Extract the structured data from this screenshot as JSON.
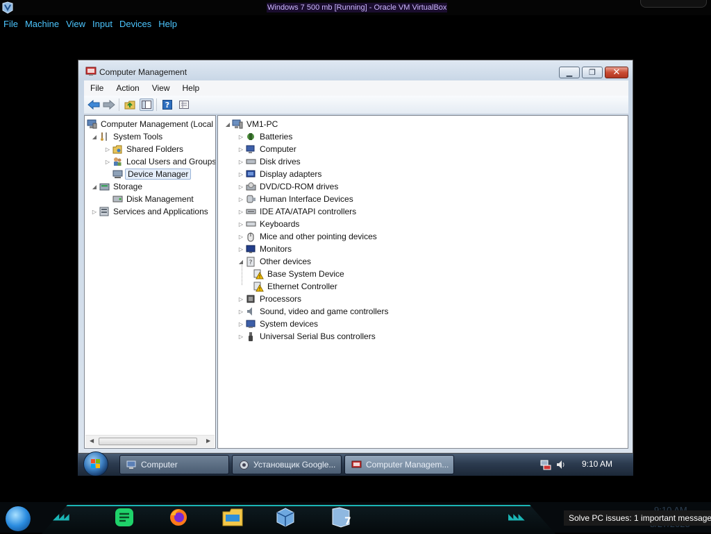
{
  "host": {
    "window_title": "Windows 7 500 mb [Running] - Oracle VM VirtualBox",
    "menu": [
      "File",
      "Machine",
      "View",
      "Input",
      "Devices",
      "Help"
    ]
  },
  "cm_window": {
    "title": "Computer Management",
    "menu": [
      "File",
      "Action",
      "View",
      "Help"
    ],
    "toolbar": [
      "back-icon",
      "forward-icon",
      "up-folder-icon",
      "show-hide-tree-icon",
      "help-icon",
      "properties-icon"
    ],
    "left_tree": [
      {
        "label": "Computer Management (Local",
        "expander": "",
        "icon": "computer-management-icon",
        "level": 0
      },
      {
        "label": "System Tools",
        "expander": "expanded",
        "icon": "tools-icon",
        "level": 1
      },
      {
        "label": "Shared Folders",
        "expander": "collapsed",
        "icon": "shared-folder-icon",
        "level": 2
      },
      {
        "label": "Local Users and Groups",
        "expander": "collapsed",
        "icon": "users-icon",
        "level": 2
      },
      {
        "label": "Device Manager",
        "expander": "",
        "icon": "device-manager-icon",
        "level": 2,
        "selected": true
      },
      {
        "label": "Storage",
        "expander": "expanded",
        "icon": "storage-icon",
        "level": 1
      },
      {
        "label": "Disk Management",
        "expander": "",
        "icon": "disk-icon",
        "level": 2
      },
      {
        "label": "Services and Applications",
        "expander": "collapsed",
        "icon": "services-icon",
        "level": 1
      }
    ],
    "device_tree": {
      "root": "VM1-PC",
      "categories": [
        {
          "label": "Batteries",
          "expander": "collapsed",
          "icon": "battery-icon"
        },
        {
          "label": "Computer",
          "expander": "collapsed",
          "icon": "computer-icon"
        },
        {
          "label": "Disk drives",
          "expander": "collapsed",
          "icon": "disk-drive-icon"
        },
        {
          "label": "Display adapters",
          "expander": "collapsed",
          "icon": "display-adapter-icon"
        },
        {
          "label": "DVD/CD-ROM drives",
          "expander": "collapsed",
          "icon": "dvd-icon"
        },
        {
          "label": "Human Interface Devices",
          "expander": "collapsed",
          "icon": "hid-icon"
        },
        {
          "label": "IDE ATA/ATAPI controllers",
          "expander": "collapsed",
          "icon": "ide-icon"
        },
        {
          "label": "Keyboards",
          "expander": "collapsed",
          "icon": "keyboard-icon"
        },
        {
          "label": "Mice and other pointing devices",
          "expander": "collapsed",
          "icon": "mouse-icon"
        },
        {
          "label": "Monitors",
          "expander": "collapsed",
          "icon": "monitor-icon"
        },
        {
          "label": "Other devices",
          "expander": "expanded",
          "icon": "unknown-device-icon"
        },
        {
          "label": "Base System Device",
          "expander": "",
          "icon": "warning-device-icon",
          "child": true
        },
        {
          "label": "Ethernet Controller",
          "expander": "",
          "icon": "warning-device-icon",
          "child": true
        },
        {
          "label": "Processors",
          "expander": "collapsed",
          "icon": "processor-icon"
        },
        {
          "label": "Sound, video and game controllers",
          "expander": "collapsed",
          "icon": "sound-icon"
        },
        {
          "label": "System devices",
          "expander": "collapsed",
          "icon": "system-device-icon"
        },
        {
          "label": "Universal Serial Bus controllers",
          "expander": "collapsed",
          "icon": "usb-icon"
        }
      ]
    }
  },
  "guest_taskbar": {
    "items": [
      {
        "label": "Computer",
        "icon": "computer-icon",
        "active": false
      },
      {
        "label": "Установщик Google...",
        "icon": "installer-icon",
        "active": false
      },
      {
        "label": "Computer Managem...",
        "icon": "computer-management-icon",
        "active": true
      }
    ],
    "tray_icons": [
      "network-icon",
      "volume-icon"
    ],
    "clock": "9:10 AM"
  },
  "host_dock": {
    "apps": [
      "start-orb-icon",
      "notes-app-icon",
      "firefox-icon",
      "file-manager-icon",
      "virtualbox-icon",
      "virtualbox-vm-icon"
    ],
    "clock": "9:10 AM",
    "date": "8/27/2025",
    "notification": "Solve PC issues: 1 important message"
  },
  "colors": {
    "host_menu": "#4cc6ff",
    "dock_accent": "#1bb5b5",
    "selection_bg": "#e5eefa",
    "selection_border": "#99b4d8",
    "warning": "#f5c000"
  }
}
